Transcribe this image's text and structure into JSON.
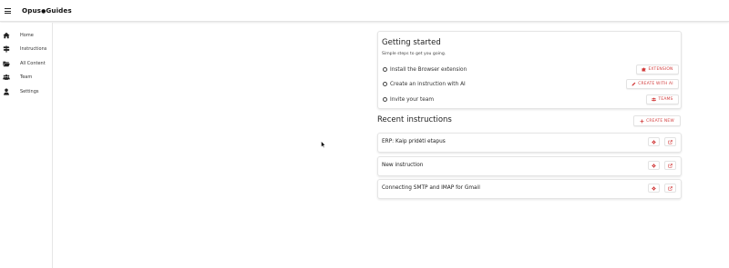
{
  "app": {
    "brand_left": "Opus",
    "brand_sep": "●",
    "brand_right": "Guides"
  },
  "sidebar": {
    "items": [
      {
        "label": "Home",
        "icon": "home-icon"
      },
      {
        "label": "Instructions",
        "icon": "signpost-icon"
      },
      {
        "label": "All Content",
        "icon": "folder-open-icon"
      },
      {
        "label": "Team",
        "icon": "users-icon"
      },
      {
        "label": "Settings",
        "icon": "user-icon"
      }
    ]
  },
  "getting_started": {
    "title": "Getting started",
    "subtitle": "Simple steps to get you going.",
    "steps": [
      {
        "label": "Install the Browser extension",
        "button": "EXTENSION",
        "icon": "puzzle-icon"
      },
      {
        "label": "Create an instruction with AI",
        "button": "CREATE WITH AI",
        "icon": "pencil-icon"
      },
      {
        "label": "Invite your team",
        "button": "TEAMS",
        "icon": "users-icon"
      }
    ]
  },
  "recent": {
    "title": "Recent instructions",
    "create_button": "CREATE NEW",
    "items": [
      {
        "title": "ERP: Kaip pridėti etapus"
      },
      {
        "title": "New instruction"
      },
      {
        "title": "Connecting SMTP and IMAP for Gmail"
      }
    ]
  },
  "colors": {
    "accent": "#d23c3c",
    "text": "#222222",
    "border": "#e5e5e5"
  }
}
